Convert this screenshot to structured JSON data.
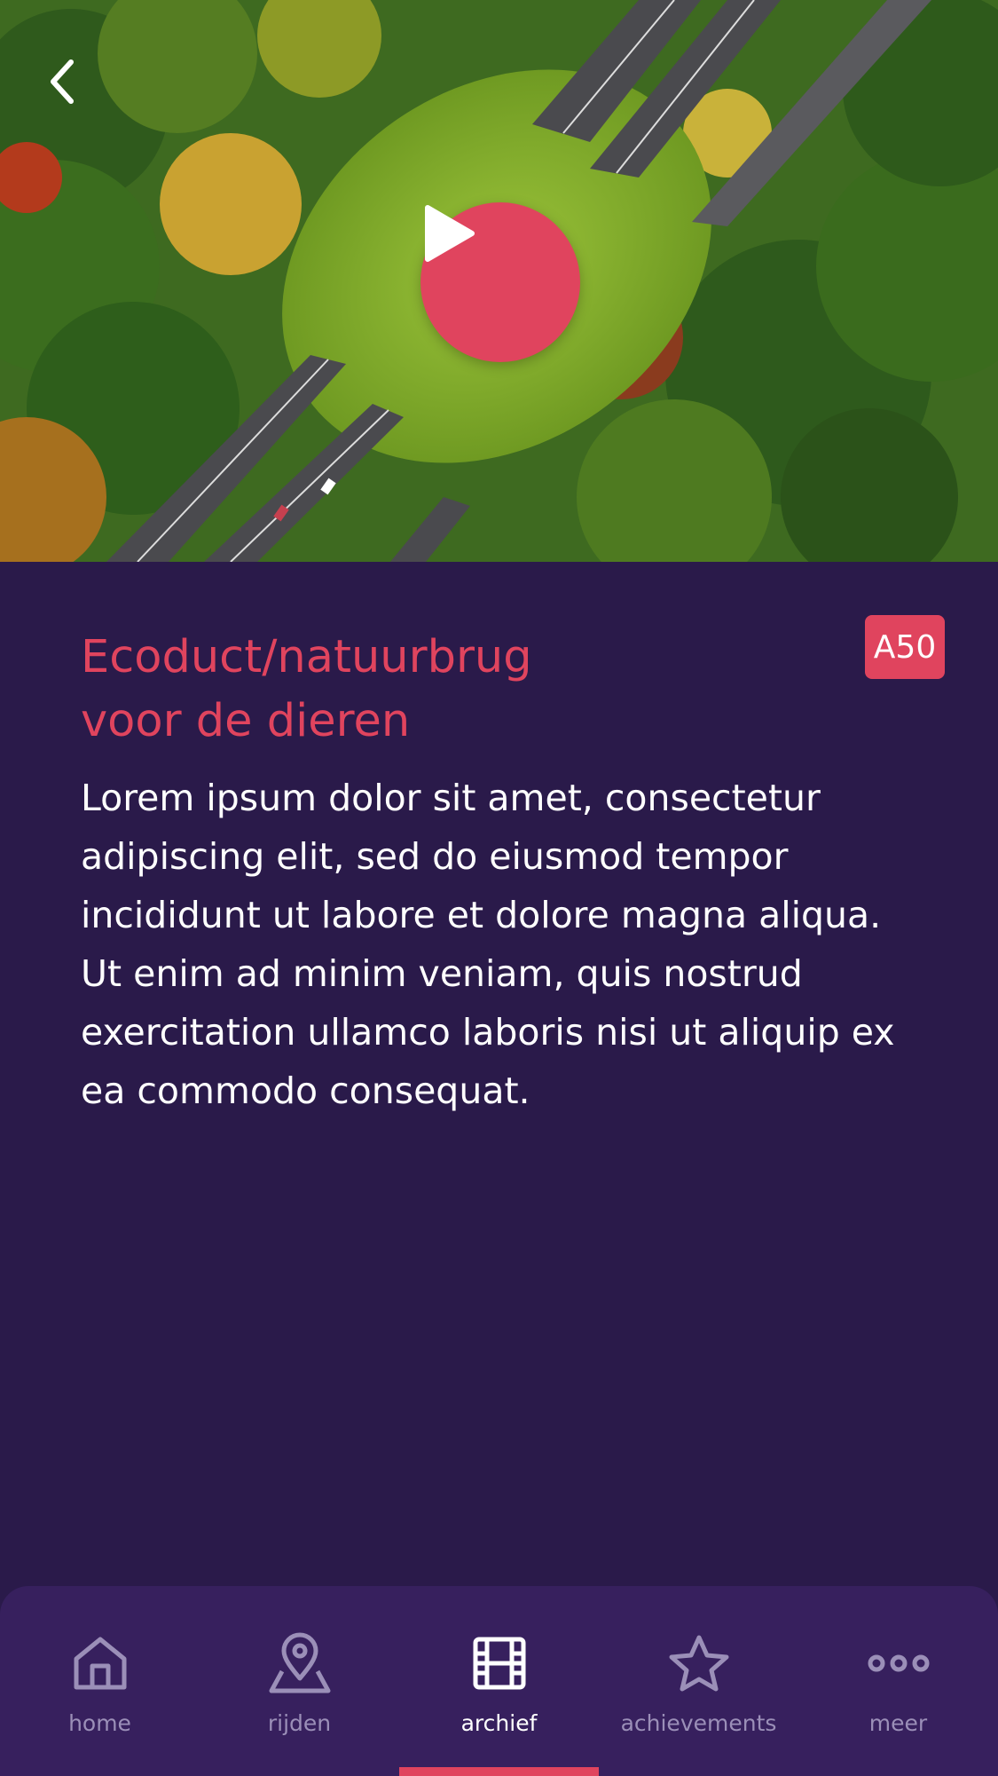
{
  "hero": {
    "back_icon": "chevron-left-icon",
    "play_icon": "play-icon"
  },
  "article": {
    "title_line1": "Ecoduct/natuurbrug",
    "title_line2": "voor de dieren",
    "badge": "A50",
    "body": "Lorem ipsum dolor sit amet, consectetur adipiscing elit, sed do eiusmod tempor incididunt ut labore et dolore magna aliqua. Ut enim ad minim veniam, quis nostrud exercitation ullamco laboris nisi ut aliquip ex ea commodo consequat."
  },
  "tabbar": {
    "items": [
      {
        "label": "home",
        "icon": "home-icon",
        "active": false
      },
      {
        "label": "rijden",
        "icon": "map-pin-icon",
        "active": false
      },
      {
        "label": "archief",
        "icon": "film-icon",
        "active": true
      },
      {
        "label": "achievements",
        "icon": "star-icon",
        "active": false
      },
      {
        "label": "meer",
        "icon": "more-icon",
        "active": false
      }
    ]
  },
  "colors": {
    "background": "#2a1a4a",
    "accent": "#e0445e",
    "tabbar": "#37205e",
    "inactive": "#9b8fb8"
  }
}
